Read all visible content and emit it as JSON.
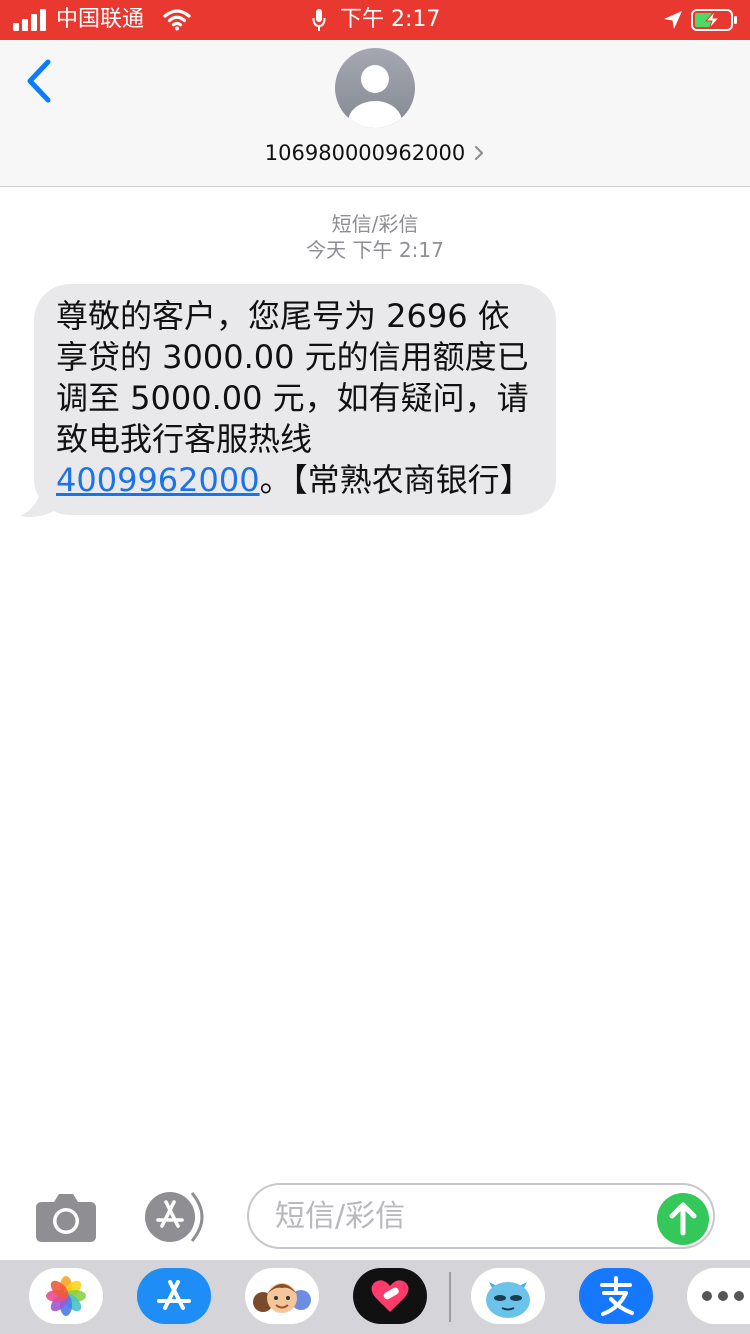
{
  "status_bar": {
    "carrier": "中国联通",
    "time": "下午 2:17",
    "icons": [
      "signal-icon",
      "wifi-icon",
      "microphone-icon",
      "location-arrow-icon",
      "battery-charging-icon"
    ],
    "color": "#e8382f"
  },
  "header": {
    "back_icon": "chevron-left-icon",
    "avatar_icon": "person-icon",
    "contact": "106980000962000",
    "contact_chevron_icon": "chevron-right-icon"
  },
  "thread": {
    "type_label": "短信/彩信",
    "timestamp": "今天 下午 2:17"
  },
  "message": {
    "text_before_link": "尊敬的客户，您尾号为 2696 依享贷的 3000.00 元的信用额度已调至 5000.00 元，如有疑问，请致电我行客服热线 ",
    "link": "4009962000",
    "text_after_link": "。【常熟农商银行】",
    "bubble_color": "#e9e9eb",
    "link_color": "#1a73e8"
  },
  "composer": {
    "camera_icon": "camera-icon",
    "apps_icon": "app-store-icon",
    "placeholder": "短信/彩信",
    "send_icon": "arrow-up-icon",
    "send_color": "#34c759"
  },
  "app_tray": {
    "items": [
      "photos-icon",
      "app-store-icon",
      "memoji-icon",
      "heart-app-icon",
      "monster-sticker-icon",
      "alipay-icon",
      "more-icon"
    ]
  }
}
